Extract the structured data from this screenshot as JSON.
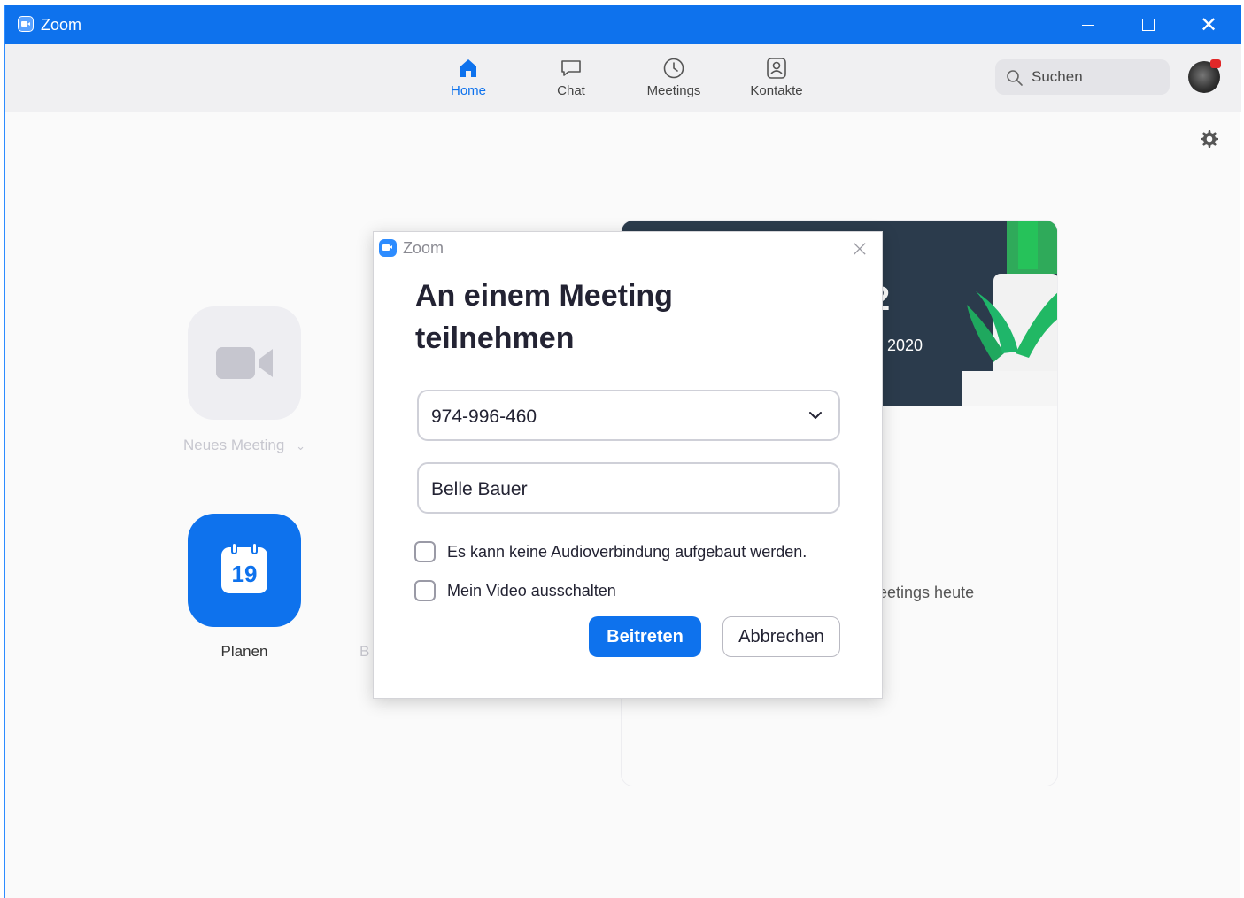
{
  "window": {
    "title": "Zoom"
  },
  "nav": {
    "items": [
      {
        "label": "Home",
        "icon": "home-icon",
        "active": true
      },
      {
        "label": "Chat",
        "icon": "chat-icon",
        "active": false
      },
      {
        "label": "Meetings",
        "icon": "clock-icon",
        "active": false
      },
      {
        "label": "Kontakte",
        "icon": "contacts-icon",
        "active": false
      }
    ],
    "search_placeholder": "Suchen"
  },
  "home": {
    "new_meeting_label": "Neues Meeting",
    "plan_label": "Planen",
    "calendar_day": "19",
    "partial_label": "B"
  },
  "card": {
    "banner_number_partial": "2",
    "banner_date_partial": "z 2020",
    "meetings_today_partial": "leetings heute"
  },
  "dialog": {
    "title": "Zoom",
    "heading": "An einem Meeting teilnehmen",
    "meeting_id": "974-996-460",
    "name": "Belle Bauer",
    "checkbox_audio": "Es kann keine Audioverbindung aufgebaut werden.",
    "checkbox_video": "Mein Video ausschalten",
    "join_button": "Beitreten",
    "cancel_button": "Abbrechen"
  },
  "colors": {
    "accent": "#0e72ed",
    "titlebar": "#0e72ed",
    "banner": "#2b3b4c"
  }
}
